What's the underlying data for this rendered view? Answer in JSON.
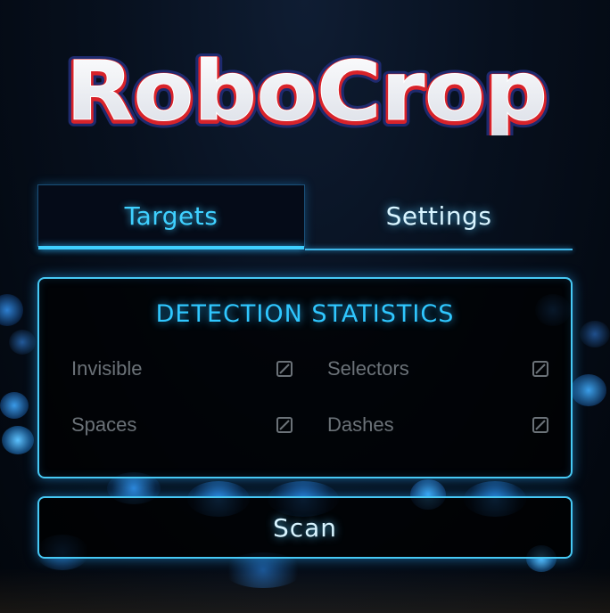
{
  "app": {
    "logo_text": "RoboCrop"
  },
  "tabs": [
    {
      "label": "Targets",
      "active": true
    },
    {
      "label": "Settings",
      "active": false
    }
  ],
  "stats": {
    "title": "DETECTION STATISTICS",
    "items": [
      {
        "label": "Invisible",
        "icon": "slashed-square-icon"
      },
      {
        "label": "Selectors",
        "icon": "slashed-square-icon"
      },
      {
        "label": "Spaces",
        "icon": "slashed-square-icon"
      },
      {
        "label": "Dashes",
        "icon": "slashed-square-icon"
      }
    ]
  },
  "scan_button": {
    "label": "Scan"
  },
  "colors": {
    "accent": "#3fd0ff",
    "logo_red": "#d8232a",
    "logo_navy": "#1e2a6e",
    "muted_text": "#6b7278"
  }
}
